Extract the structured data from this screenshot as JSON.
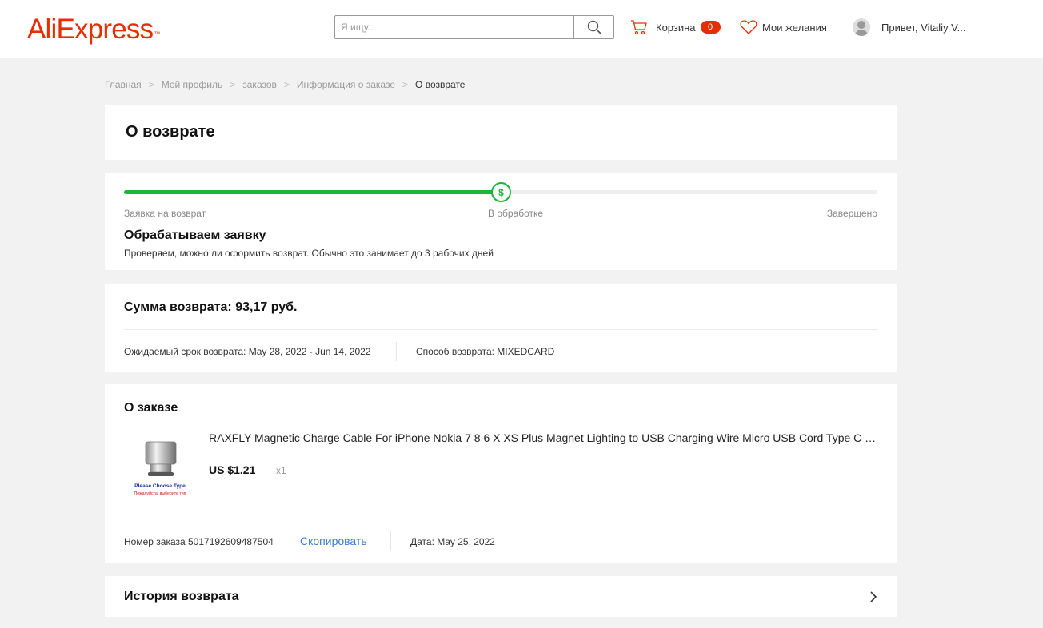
{
  "header": {
    "logo": "AliExpress",
    "logo_mark": "™",
    "search_placeholder": "Я ищу...",
    "cart_label": "Корзина",
    "cart_count": "0",
    "wishlist_label": "Мои желания",
    "user_greeting": "Привет, Vitaliy V..."
  },
  "breadcrumb": {
    "items": [
      "Главная",
      "Мой профиль",
      "заказов",
      "Информация о заказе"
    ],
    "current": "О возврате",
    "separator": ">"
  },
  "page_title": "О возврате",
  "progress": {
    "fraction": 0.5,
    "step_icon": "$",
    "steps": [
      "Заявка на возврат",
      "В обработке",
      "Завершено"
    ],
    "title": "Обрабатываем заявку",
    "description": "Проверяем, можно ли оформить возврат. Обычно это занимает до 3 рабочих дней",
    "color": "#1bb537"
  },
  "refund": {
    "amount": "Сумма возврата: 93,17 руб.",
    "expected": "Ожидаемый срок возврата: May 28, 2022 - Jun 14, 2022",
    "method": "Способ возврата: MIXEDCARD"
  },
  "order": {
    "title": "О заказе",
    "product_name": "RAXFLY Magnetic Charge Cable For iPhone Nokia 7 8 6 X XS Plus Magnet Lighting to USB Charging Wire Micro USB Cord Type C Cable",
    "image_caption_en": "Please Choose Type",
    "image_caption_ru": "Пожалуйста, выберите тип",
    "price": "US $1.21",
    "qty": "x1",
    "order_number": "Номер заказа 5017192609487504",
    "copy_label": "Скопировать",
    "date": "Дата: May 25, 2022"
  },
  "history": {
    "title": "История возврата"
  },
  "colors": {
    "brand": "#e62e04",
    "accent_green": "#1bb537",
    "link": "#3a7bd5"
  }
}
